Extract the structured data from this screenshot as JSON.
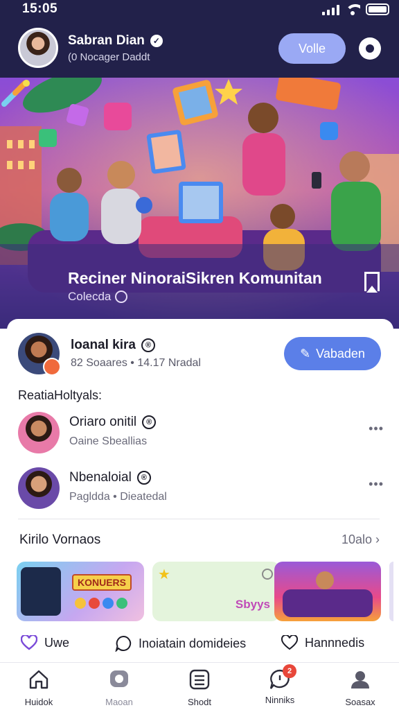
{
  "status_bar": {
    "time": "15:05"
  },
  "header": {
    "name": "Sabran Dian",
    "subtitle": "(0 Nocager Daddt",
    "follow_label": "Volle",
    "icons": {
      "verified": "verified-badge-icon",
      "settings": "settings-icon"
    }
  },
  "hero": {
    "title": "Reciner NinoraiSikren  Komunitan",
    "subtitle": "Colecda"
  },
  "owner": {
    "name": "loanal kira",
    "meta_prefix": "82",
    "meta": "Soaares  •  14.17 Nradal",
    "join_label": "Vabaden"
  },
  "section_label": "ReatiaHoltyals:",
  "members": [
    {
      "name": "Oriaro onitil",
      "sub": "Oaine Sbeallias"
    },
    {
      "name": "Nbenaloial",
      "sub": "Pagldda  •  Dieatedal"
    }
  ],
  "recommend": {
    "title": "Kirilo Vornaos",
    "link": "10alo",
    "thumbs": [
      {
        "label": "KONUERS"
      },
      {
        "label": "Sbyys"
      },
      {
        "label": ""
      }
    ]
  },
  "actions": [
    {
      "label": "Uwe"
    },
    {
      "label": "Inoiatain domideies"
    },
    {
      "label": "Hannnedis"
    }
  ],
  "nav": {
    "items": [
      {
        "label": "Huidok",
        "icon": "home-icon"
      },
      {
        "label": "Maoan",
        "icon": "chat-icon"
      },
      {
        "label": "Shodt",
        "icon": "list-icon"
      },
      {
        "label": "Ninniks",
        "icon": "notifications-icon",
        "badge": "2"
      },
      {
        "label": "Soasax",
        "icon": "profile-icon"
      }
    ]
  },
  "colors": {
    "header_bg": "#22214a",
    "accent": "#5b7fe8",
    "badge": "#e8473a"
  }
}
